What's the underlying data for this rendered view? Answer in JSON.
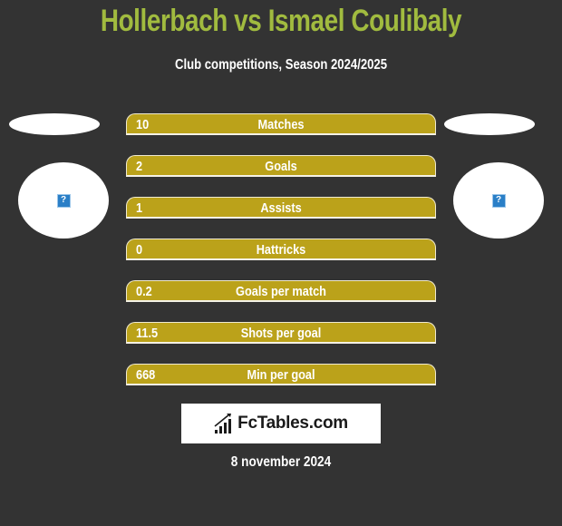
{
  "header": {
    "title": "Hollerbach vs Ismael Coulibaly",
    "subtitle": "Club competitions, Season 2024/2025"
  },
  "players": {
    "left": {
      "name": "Hollerbach",
      "avatar_icon": "missing-image-icon",
      "avatar_glyph": "?"
    },
    "right": {
      "name": "Ismael Coulibaly",
      "avatar_icon": "missing-image-icon",
      "avatar_glyph": "?"
    }
  },
  "colors": {
    "title": "#a1bb3f",
    "bar_fill": "#bba21a",
    "background": "#333333"
  },
  "stats": [
    {
      "label": "Matches",
      "left_value": "10"
    },
    {
      "label": "Goals",
      "left_value": "2"
    },
    {
      "label": "Assists",
      "left_value": "1"
    },
    {
      "label": "Hattricks",
      "left_value": "0"
    },
    {
      "label": "Goals per match",
      "left_value": "0.2"
    },
    {
      "label": "Shots per goal",
      "left_value": "11.5"
    },
    {
      "label": "Min per goal",
      "left_value": "668"
    }
  ],
  "footer": {
    "logo_text": "FcTables.com",
    "logo_icon": "bar-chart-icon",
    "date": "8 november 2024"
  }
}
